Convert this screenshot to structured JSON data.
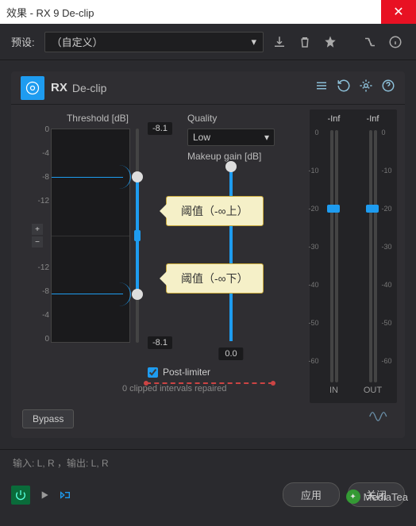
{
  "window": {
    "title": "效果 - RX 9 De-clip"
  },
  "preset": {
    "label": "预设:",
    "value": "（自定义）"
  },
  "plugin": {
    "brand": "RX",
    "name": "De-clip"
  },
  "threshold": {
    "label": "Threshold [dB]",
    "value_top": "-8.1",
    "value_bottom": "-8.1",
    "scale_top": [
      "0",
      "-4",
      "-8",
      "-12"
    ],
    "scale_bottom": [
      "-12",
      "-8",
      "-4",
      "0"
    ]
  },
  "quality": {
    "label": "Quality",
    "value": "Low"
  },
  "makeup": {
    "label": "Makeup gain [dB]",
    "value": "0.0"
  },
  "post_limiter": {
    "label": "Post-limiter",
    "checked": true
  },
  "status": {
    "clipped": "0 clipped intervals repaired"
  },
  "meters": {
    "in": {
      "label": "IN",
      "peak": "-Inf"
    },
    "out": {
      "label": "OUT",
      "peak": "-Inf"
    },
    "ticks": [
      "0",
      "-10",
      "-20",
      "-30",
      "-40",
      "-50",
      "-60"
    ]
  },
  "bypass": {
    "label": "Bypass"
  },
  "io": {
    "text": "输入: L, R ，输出: L, R"
  },
  "buttons": {
    "apply": "应用",
    "close": "关闭"
  },
  "annotations": {
    "upper": "阈值（-∞上）",
    "lower": "阈值（-∞下）"
  },
  "watermark": "MediaTea",
  "chart_data": {
    "type": "threshold_envelope",
    "threshold_db": -8.1,
    "symmetric": true,
    "makeup_gain_db": 0.0,
    "meter_range_db": [
      -60,
      0
    ]
  }
}
